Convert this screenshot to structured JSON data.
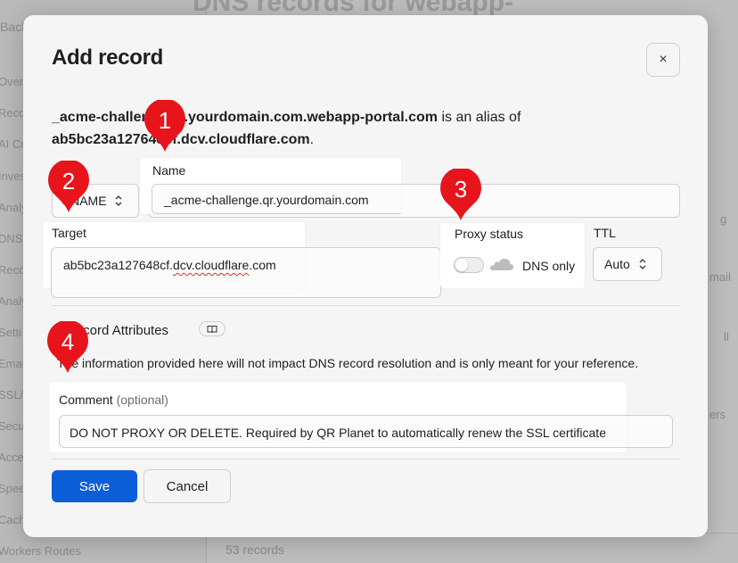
{
  "background": {
    "title": "DNS records for webapp-",
    "back_label": "Back",
    "nav_items": [
      "Overv",
      "Reco",
      "AI Cr",
      "Inves",
      "Analy",
      "DNS",
      "Reco",
      "Analy",
      "Setti",
      "Emai",
      "SSL/T",
      "Secu",
      "Acce",
      "Spee",
      "Cach",
      "Workers Routes"
    ],
    "right_fragments": [
      "g",
      "mail",
      "ll",
      "ers"
    ],
    "records_count": "53 records"
  },
  "modal": {
    "title": "Add record",
    "close_icon": "×",
    "alias_sentence": {
      "name_part": "_acme-challenge.qr.yourdomain.com.webapp-portal.com",
      "connector": " is an alias of ",
      "target_part": "ab5bc23a127648cf.dcv.cloudflare.com",
      "end": "."
    },
    "type": {
      "value": "CNAME",
      "chevron": "⌃⌄"
    },
    "name": {
      "label": "Name",
      "value": "_acme-challenge.qr.yourdomain.com"
    },
    "target": {
      "label": "Target",
      "value_pre": "ab5bc23a127648cf.",
      "value_misspelled": "dcv.cloudflare",
      "value_post": ".com"
    },
    "proxy": {
      "label": "Proxy status",
      "enabled": false,
      "status_text": "DNS only"
    },
    "ttl": {
      "label": "TTL",
      "value": "Auto"
    },
    "record_attributes": {
      "heading": "Record Attributes",
      "info_text": "The information provided here will not impact DNS record resolution and is only meant for your reference."
    },
    "comment": {
      "label": "Comment",
      "optional": "(optional)",
      "value": "DO NOT PROXY OR DELETE. Required by QR Planet to automatically renew the SSL certificate"
    },
    "save_label": "Save",
    "cancel_label": "Cancel"
  },
  "markers": [
    "1",
    "2",
    "3",
    "4"
  ],
  "colors": {
    "marker_red": "#e8141c",
    "save_blue": "#0b5ed7",
    "spellcheck_red": "#d93025"
  }
}
